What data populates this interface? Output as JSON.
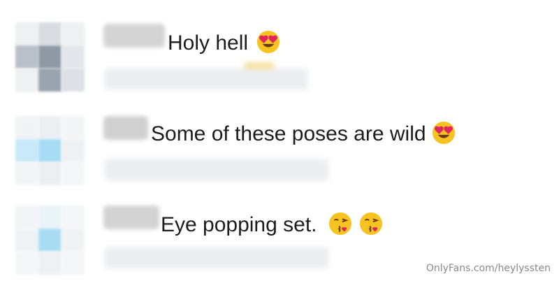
{
  "comments": [
    {
      "text": "Holy hell",
      "emojis": [
        "heart-eyes-emoji"
      ]
    },
    {
      "text": "Some of these poses are wild",
      "emojis": [
        "heart-eyes-emoji"
      ]
    },
    {
      "text": "Eye popping set.",
      "emojis": [
        "kissing-face-emoji",
        "kissing-face-emoji"
      ]
    }
  ],
  "watermark": "OnlyFans.com/heylyssten",
  "colors": {
    "text": "#1c1c1c",
    "watermark": "#8a8a8a",
    "emoji_face": "#f7c321",
    "emoji_heart": "#e0245e"
  }
}
